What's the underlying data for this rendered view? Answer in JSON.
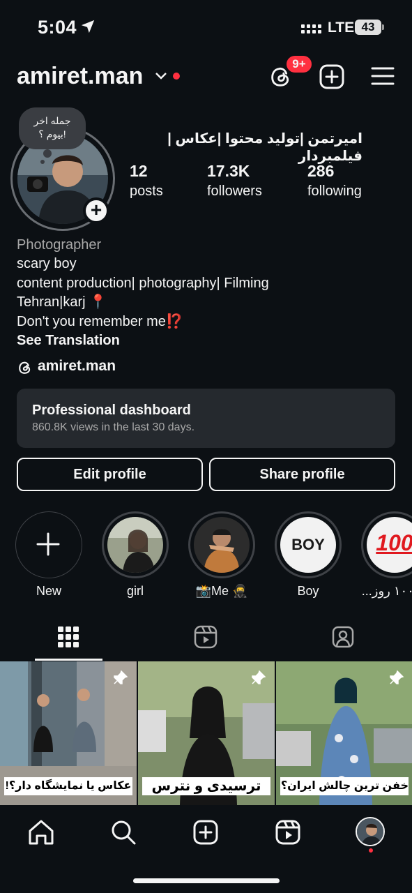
{
  "status_bar": {
    "time": "5:04",
    "network": "LTE",
    "battery": "43"
  },
  "header": {
    "username": "amiret.man",
    "notification_badge": "9+"
  },
  "profile": {
    "note": [
      "جمله اخر",
      "بیوم ؟!"
    ],
    "full_name": "امیرتمن |تولید محتوا |عکاس |فیلمبردار",
    "stats": [
      {
        "value": "12",
        "label": "posts"
      },
      {
        "value": "17.3K",
        "label": "followers"
      },
      {
        "value": "286",
        "label": "following"
      }
    ],
    "category": "Photographer",
    "bio_lines": [
      "scary boy",
      "content production| photography| Filming",
      "Tehran|karj 📍",
      "Don't you remember me⁉️"
    ],
    "see_translation": "See Translation",
    "threads_handle": "amiret.man"
  },
  "dashboard": {
    "title": "Professional dashboard",
    "subtitle": "860.8K views in the last 30 days."
  },
  "buttons": {
    "edit": "Edit profile",
    "share": "Share profile"
  },
  "highlights": [
    {
      "label": "New"
    },
    {
      "label": "girl"
    },
    {
      "label": "📸Me 🥷"
    },
    {
      "label": "Boy",
      "cover_text": "BOY"
    },
    {
      "label": "تو ۱۰۰ روز...",
      "cover_text": "100"
    }
  ],
  "posts": [
    {
      "caption": "عکاس یا نمایشگاه دار؟!",
      "pinned": true
    },
    {
      "caption": "ترسیدی و نترس",
      "pinned": true
    },
    {
      "caption": "خفن ترین چالش ایران؟!",
      "pinned": true
    }
  ],
  "colors": {
    "background": "#0c1014",
    "accent_red": "#ff3040",
    "card": "#25292e",
    "muted_text": "#a8a8a8"
  },
  "icons": [
    "location-arrow-icon",
    "signal-icon",
    "chevron-down-icon",
    "threads-icon",
    "plus-square-icon",
    "hamburger-icon",
    "grid-icon",
    "reels-icon",
    "tagged-icon",
    "pin-icon",
    "home-icon",
    "search-icon",
    "create-icon"
  ]
}
